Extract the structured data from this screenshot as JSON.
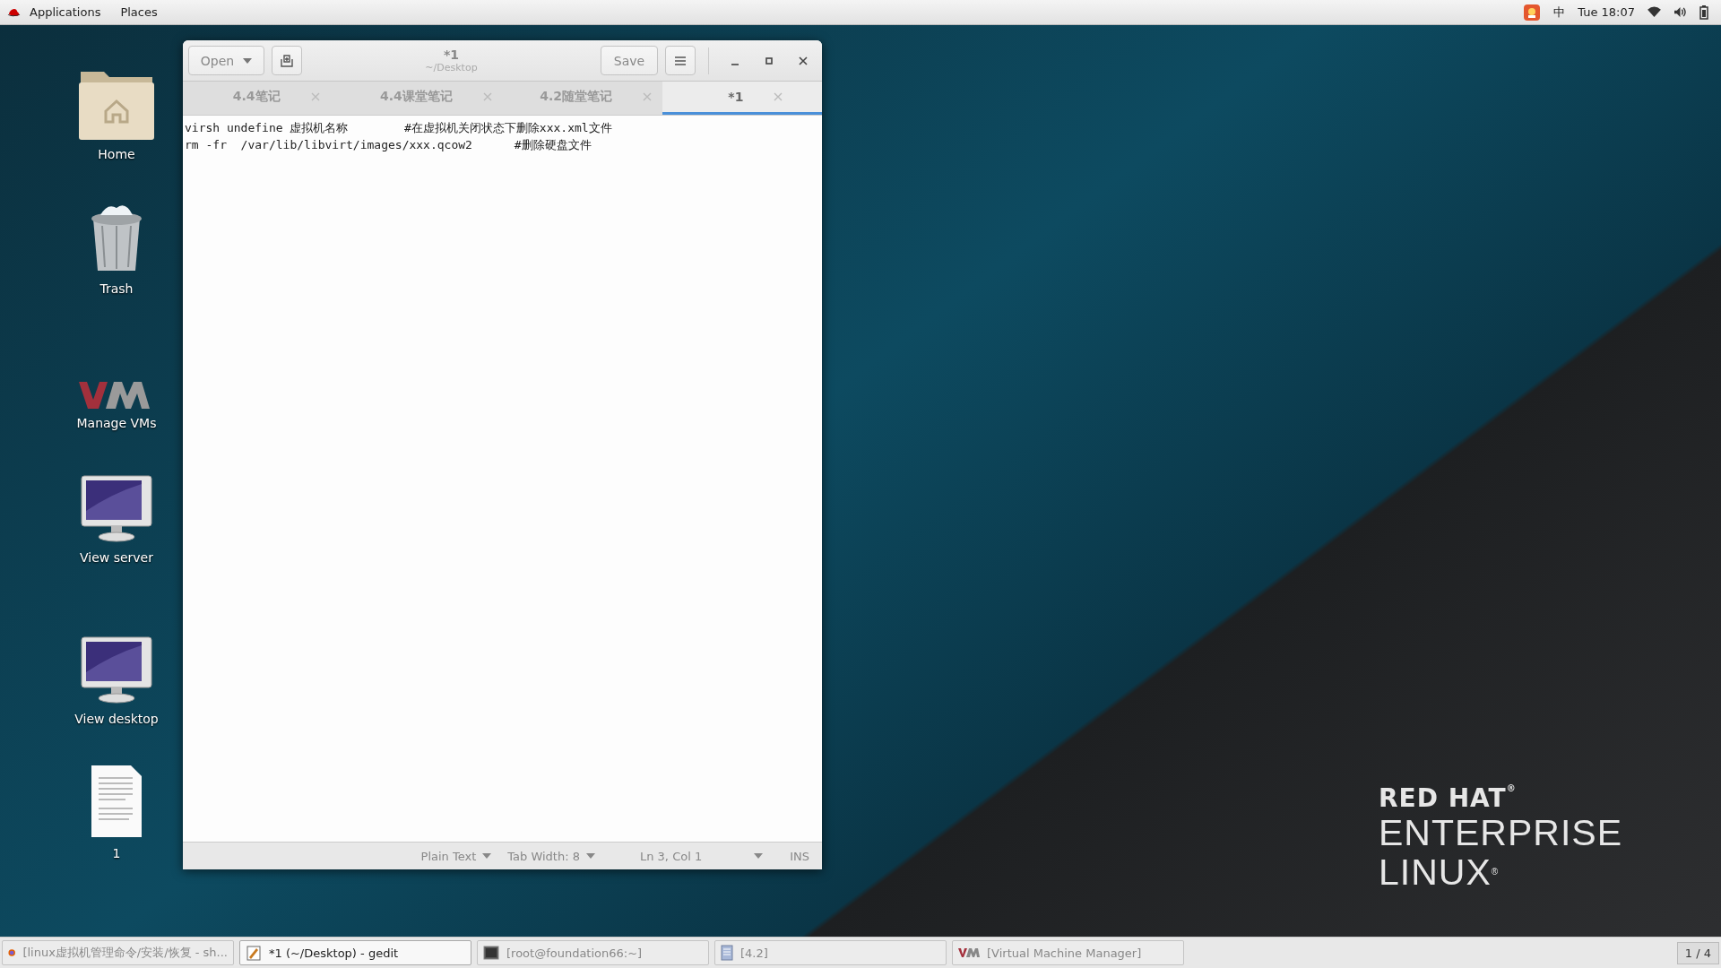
{
  "top_bar": {
    "menus": [
      "Applications",
      "Places"
    ],
    "input_method": "中",
    "clock": "Tue 18:07"
  },
  "desktop_icons": [
    {
      "kind": "folder",
      "label": "Home"
    },
    {
      "kind": "trash",
      "label": "Trash"
    },
    {
      "kind": "vm",
      "label": "Manage VMs"
    },
    {
      "kind": "monitor",
      "label": "View server"
    },
    {
      "kind": "monitor",
      "label": "View desktop"
    },
    {
      "kind": "document",
      "label": "1"
    }
  ],
  "editor": {
    "open_button": "Open",
    "title": "*1",
    "subtitle": "~/Desktop",
    "save_button": "Save",
    "tabs": [
      {
        "label": "4.4笔记",
        "selected": false
      },
      {
        "label": "4.4课堂笔记",
        "selected": false
      },
      {
        "label": "4.2随堂笔记",
        "selected": false
      },
      {
        "label": "*1",
        "selected": true
      }
    ],
    "lines": [
      "virsh undefine 虚拟机名称        #在虚拟机关闭状态下删除xxx.xml文件",
      "rm -fr  /var/lib/libvirt/images/xxx.qcow2      #删除硬盘文件"
    ],
    "status_bar": {
      "language": "Plain Text",
      "tab_width": "Tab Width: 8",
      "position": "Ln 3, Col 1",
      "mode": "INS"
    }
  },
  "logo": {
    "line_1": "RED HAT$^{®}$",
    "line_2": "ENTERPRISE",
    "line_3": "LINUX$^{®}$"
  },
  "taskbar": {
    "items": [
      {
        "kind": "browser",
        "label": "[linux虚拟机管理命令/安装/恢复 - sh...",
        "selected": false
      },
      {
        "kind": "editor",
        "label": "*1 (~/Desktop) - gedit",
        "selected": true
      },
      {
        "kind": "terminal",
        "label": "[root@foundation66:~]",
        "selected": false
      },
      {
        "kind": "document",
        "label": "[4.2]",
        "selected": false
      },
      {
        "kind": "vm",
        "label": "[Virtual Machine Manager]",
        "selected": false
      }
    ],
    "workspace": "1 / 4"
  }
}
